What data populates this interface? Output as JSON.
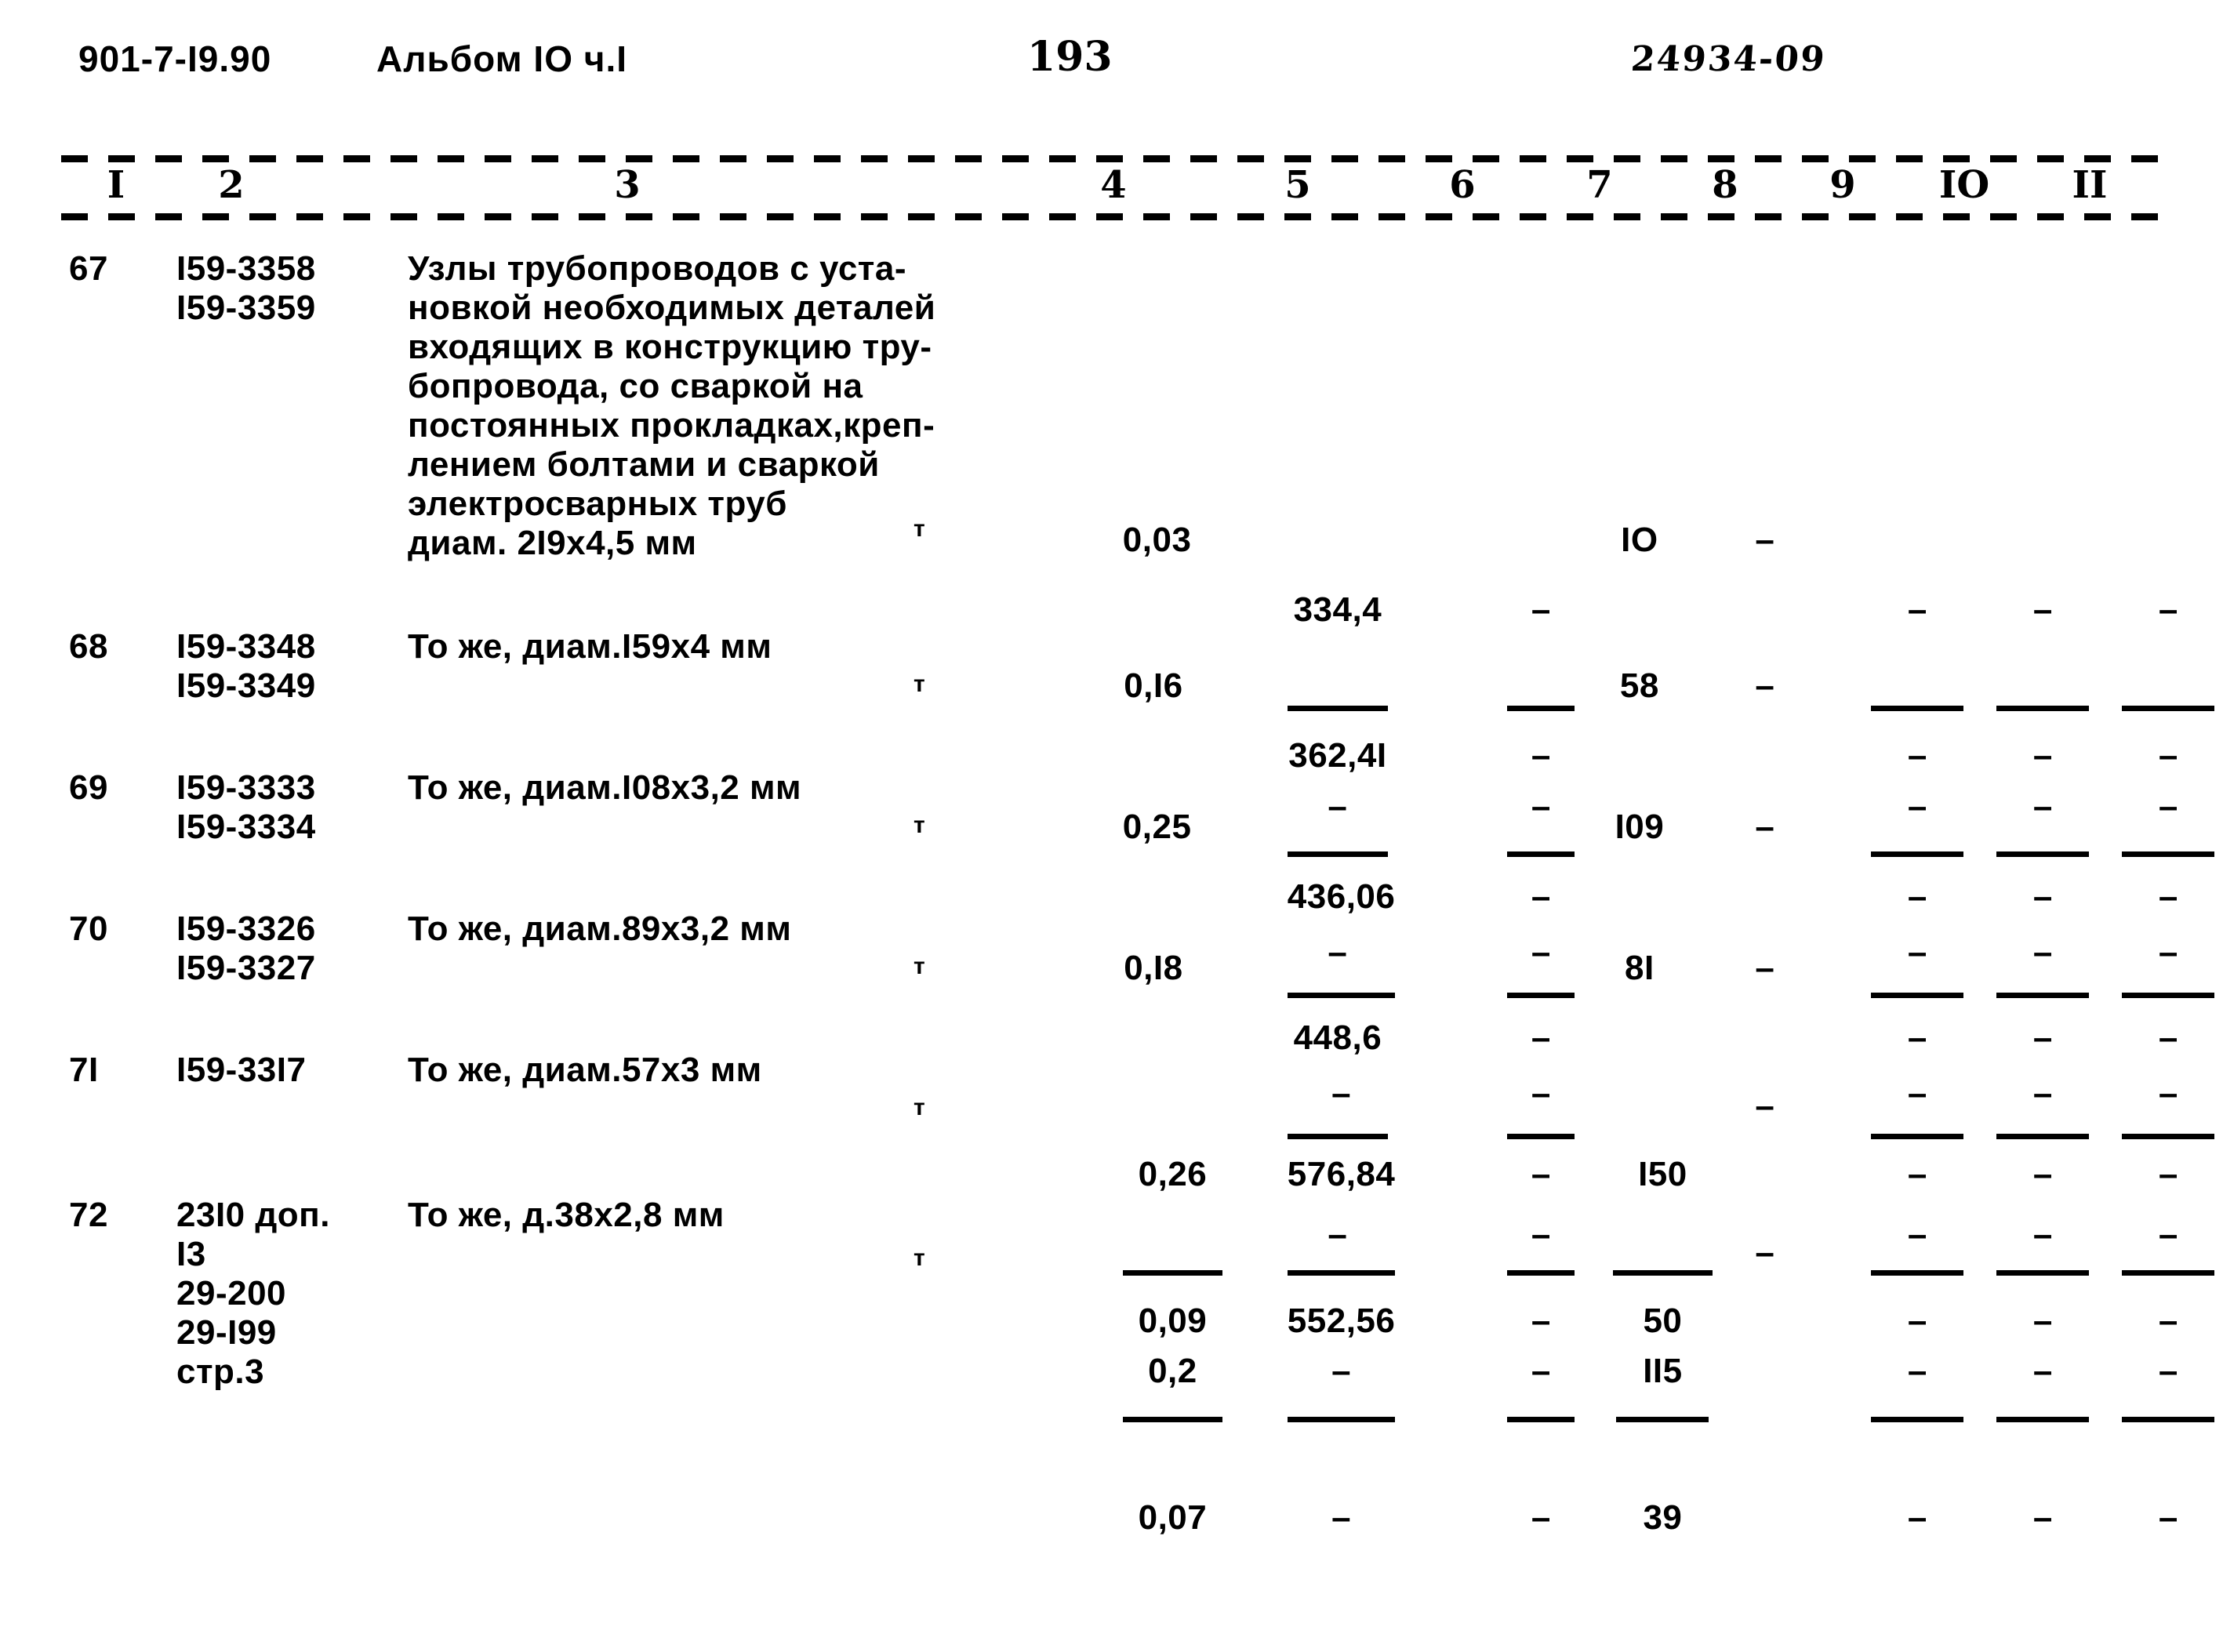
{
  "header": {
    "doc_code": "901-7-I9.90",
    "album": "Альбом IO ч.I",
    "page_number": "193",
    "stamp": "24934-09"
  },
  "table": {
    "column_headers": [
      "I",
      "2",
      "3",
      "4",
      "5",
      "6",
      "7",
      "8",
      "9",
      "IO",
      "II"
    ],
    "unit_symbol": "т",
    "dash": "–",
    "rows": [
      {
        "num": "67",
        "codes": "I59-3358\nI59-3359",
        "description": "Узлы трубопроводов с уста-\nновкой необходимых деталей\nвходящих в конструкцию тру-\nбопровода, со сваркой на\nпостоянных прокладках,креп-\nлением болтами и сваркой\nэлектросварных труб\nдиам. 2I9x4,5 мм",
        "col4_num": "0,03",
        "col4_den": "",
        "col5_num": "334,4",
        "col5_den": "–",
        "col6_num": "–",
        "col6_den": "–",
        "col7_num": "IO",
        "col7_den": "",
        "col8": "–",
        "col9_num": "–",
        "col9_den": "–",
        "col10_num": "–",
        "col10_den": "–",
        "col11_num": "–",
        "col11_den": "–"
      },
      {
        "num": "68",
        "codes": "I59-3348\nI59-3349",
        "description": "То же, диам.I59x4 мм",
        "col4_num": "0,I6",
        "col4_den": "",
        "col5_num": "362,4I",
        "col5_den": "–",
        "col6_num": "–",
        "col6_den": "–",
        "col7_num": "58",
        "col7_den": "",
        "col8": "–",
        "col9_num": "–",
        "col9_den": "–",
        "col10_num": "–",
        "col10_den": "–",
        "col11_num": "–",
        "col11_den": "–"
      },
      {
        "num": "69",
        "codes": "I59-3333\nI59-3334",
        "description": "То же, диам.I08x3,2 мм",
        "col4_num": "0,25",
        "col4_den": "",
        "col5_num": "436,06",
        "col5_den": "–",
        "col6_num": "–",
        "col6_den": "–",
        "col7_num": "I09",
        "col7_den": "",
        "col8": "–",
        "col9_num": "–",
        "col9_den": "–",
        "col10_num": "–",
        "col10_den": "–",
        "col11_num": "–",
        "col11_den": "–"
      },
      {
        "num": "70",
        "codes": "I59-3326\nI59-3327",
        "description": "То же, диам.89x3,2 мм",
        "col4_num": "0,I8",
        "col4_den": "",
        "col5_num": "448,6",
        "col5_den": "–",
        "col6_num": "–",
        "col6_den": "–",
        "col7_num": "8I",
        "col7_den": "",
        "col8": "–",
        "col9_num": "–",
        "col9_den": "–",
        "col10_num": "–",
        "col10_den": "–",
        "col11_num": "–",
        "col11_den": "–"
      },
      {
        "num": "7I",
        "codes": "I59-33I7",
        "description": "То же, диам.57x3 мм",
        "col4_num": "0,26",
        "col4_den": "0,2",
        "col5_num": "576,84",
        "col5_den": "–",
        "col6_num": "–",
        "col6_den": "–",
        "col7_num": "I50",
        "col7_den": "II5",
        "col8": "–",
        "col9_num": "–",
        "col9_den": "–",
        "col10_num": "–",
        "col10_den": "–",
        "col11_num": "–",
        "col11_den": "–"
      },
      {
        "num": "72",
        "codes": "23I0 доп.\nI3\n29-200\n29-I99\nстр.3",
        "description": "То же, д.38x2,8 мм",
        "col4_num": "0,09",
        "col4_den": "0,07",
        "col5_num": "552,56",
        "col5_den": "–",
        "col6_num": "–",
        "col6_den": "–",
        "col7_num": "50",
        "col7_den": "39",
        "col8": "–",
        "col9_num": "–",
        "col9_den": "–",
        "col10_num": "–",
        "col10_den": "–",
        "col11_num": "–",
        "col11_den": "–"
      }
    ]
  }
}
